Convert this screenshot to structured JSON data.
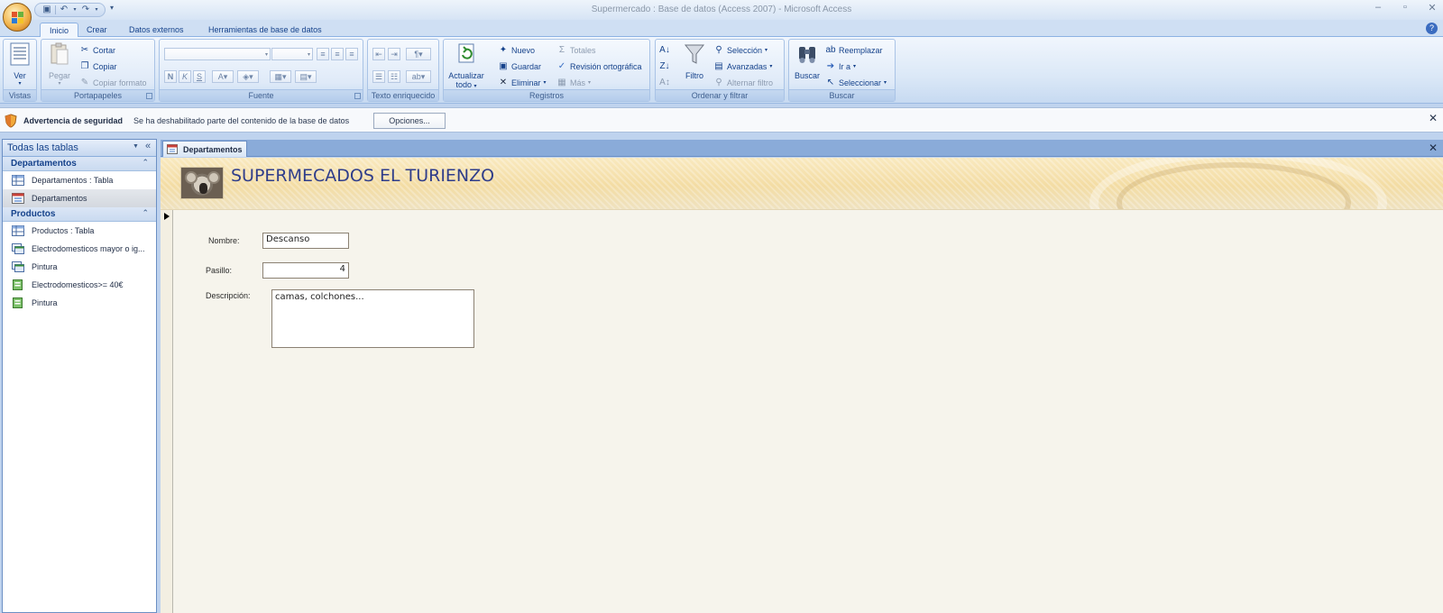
{
  "window": {
    "title": "Supermercado : Base de datos (Access 2007) - Microsoft Access",
    "controls": [
      "minimize-icon",
      "restore-icon",
      "close-icon"
    ]
  },
  "ribbon": {
    "tabs": [
      "Inicio",
      "Crear",
      "Datos externos",
      "Herramientas de base de datos"
    ],
    "active_tab": "Inicio",
    "groups": {
      "vistas": {
        "label": "Vistas",
        "ver": "Ver"
      },
      "portapapeles": {
        "label": "Portapapeles",
        "pegar": "Pegar",
        "cortar": "Cortar",
        "copiar": "Copiar",
        "copiar_formato": "Copiar formato"
      },
      "fuente": {
        "label": "Fuente",
        "bold": "N",
        "italic": "K",
        "underline": "S"
      },
      "texto": {
        "label": "Texto enriquecido"
      },
      "registros": {
        "label": "Registros",
        "actualizar_1": "Actualizar",
        "actualizar_2": "todo",
        "nuevo": "Nuevo",
        "guardar": "Guardar",
        "eliminar": "Eliminar",
        "totales": "Totales",
        "revision": "Revisión ortográfica",
        "mas": "Más"
      },
      "ordenar": {
        "label": "Ordenar y filtrar",
        "filtro": "Filtro",
        "seleccion": "Selección",
        "avanzadas": "Avanzadas",
        "alternar": "Alternar filtro"
      },
      "buscar": {
        "label": "Buscar",
        "buscar": "Buscar",
        "reemplazar": "Reemplazar",
        "ir_a": "Ir a",
        "seleccionar": "Seleccionar"
      }
    }
  },
  "security": {
    "title": "Advertencia de seguridad",
    "message": "Se ha deshabilitado parte del contenido de la base de datos",
    "button": "Opciones..."
  },
  "nav": {
    "header": "Todas las tablas",
    "groups": [
      {
        "label": "Departamentos",
        "items": [
          {
            "label": "Departamentos : Tabla",
            "icon": "table-icon"
          },
          {
            "label": "Departamentos",
            "icon": "form-icon"
          }
        ]
      },
      {
        "label": "Productos",
        "items": [
          {
            "label": "Productos : Tabla",
            "icon": "table-icon"
          },
          {
            "label": "Electrodomesticos mayor o ig...",
            "icon": "query-icon"
          },
          {
            "label": "Pintura",
            "icon": "query-icon"
          },
          {
            "label": "Electrodomesticos>= 40€",
            "icon": "report-icon"
          },
          {
            "label": "Pintura",
            "icon": "report-icon"
          }
        ]
      }
    ]
  },
  "document": {
    "tab_label": "Departamentos",
    "form_title": "SUPERMECADOS EL TURIENZO",
    "fields": {
      "nombre": {
        "label": "Nombre:",
        "value": "Descanso"
      },
      "pasillo": {
        "label": "Pasillo:",
        "value": "4"
      },
      "descripcion": {
        "label": "Descripción:",
        "value": "camas, colchones..."
      }
    }
  },
  "colors": {
    "accent": "#15428b",
    "ribbon": "#dbe8f7",
    "form_bg": "#f6f4ec",
    "title_text": "#2f3d8a"
  }
}
